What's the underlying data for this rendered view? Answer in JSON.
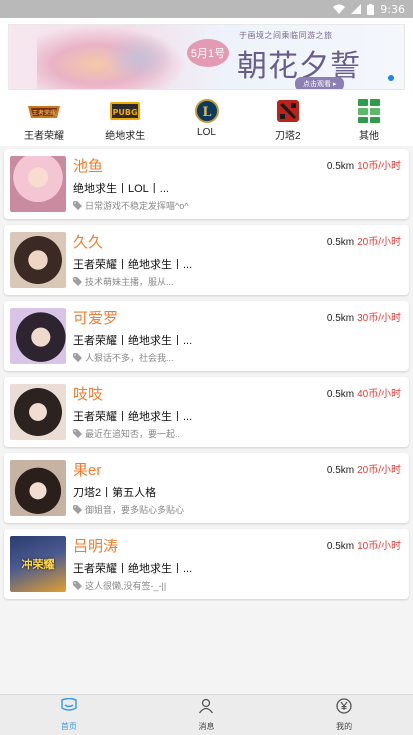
{
  "status_bar": {
    "time": "9:36"
  },
  "banner": {
    "date_badge": "5月1号",
    "subline": "于画境之间乘临同游之旅",
    "title": "朝花夕誓",
    "cta": "点击观看 ▸"
  },
  "categories": [
    {
      "label": "王者荣耀",
      "icon": "honor-of-kings-icon",
      "badge_text": "王者荣耀"
    },
    {
      "label": "绝地求生",
      "icon": "pubg-icon",
      "badge_text": "PUBG"
    },
    {
      "label": "LOL",
      "icon": "lol-icon",
      "badge_text": "L"
    },
    {
      "label": "刀塔2",
      "icon": "dota2-icon"
    },
    {
      "label": "其他",
      "icon": "grid-apps-icon"
    }
  ],
  "players": [
    {
      "name": "池鱼",
      "distance": "0.5km",
      "price": "10币/小时",
      "games": "绝地求生丨LOL丨...",
      "bio": "日常游戏不稳定发挥喵^o^",
      "avatar_colors": [
        "#f4c6d3",
        "#c98ba0"
      ]
    },
    {
      "name": "久久",
      "distance": "0.5km",
      "price": "20币/小时",
      "games": "王者荣耀丨绝地求生丨...",
      "bio": "技术萌妹主播，服从...",
      "avatar_colors": [
        "#d9c8b8",
        "#3b2a24"
      ]
    },
    {
      "name": "可爱罗",
      "distance": "0.5km",
      "price": "30币/小时",
      "games": "王者荣耀丨绝地求生丨...",
      "bio": "人狠话不多，社会我...",
      "avatar_colors": [
        "#d8c4e6",
        "#2e2430"
      ]
    },
    {
      "name": "吱吱",
      "distance": "0.5km",
      "price": "40币/小时",
      "games": "王者荣耀丨绝地求生丨...",
      "bio": "最近在追知否，要一起..",
      "avatar_colors": [
        "#e9ddd6",
        "#2c2220"
      ]
    },
    {
      "name": "果er",
      "distance": "0.5km",
      "price": "20币/小时",
      "games": "刀塔2丨第五人格",
      "bio": "御姐音，要多贴心多贴心",
      "avatar_colors": [
        "#c7b3a4",
        "#2b1f1c"
      ]
    },
    {
      "name": "吕明涛",
      "distance": "0.5km",
      "price": "10币/小时",
      "games": "王者荣耀丨绝地求生丨...",
      "bio": "这人很懒,没有签-_-||",
      "avatar_colors": [
        "#2a3c6e",
        "#e0a030"
      ],
      "avatar_text": "冲荣耀"
    }
  ],
  "bottom_nav": [
    {
      "label": "首页",
      "icon": "home-chat-icon",
      "active": true
    },
    {
      "label": "消息",
      "icon": "person-icon",
      "active": false
    },
    {
      "label": "我的",
      "icon": "yen-coin-icon",
      "active": false
    }
  ],
  "colors": {
    "name_orange": "#ef7d2f",
    "price_red": "#e53935",
    "nav_active": "#3d9be9"
  }
}
